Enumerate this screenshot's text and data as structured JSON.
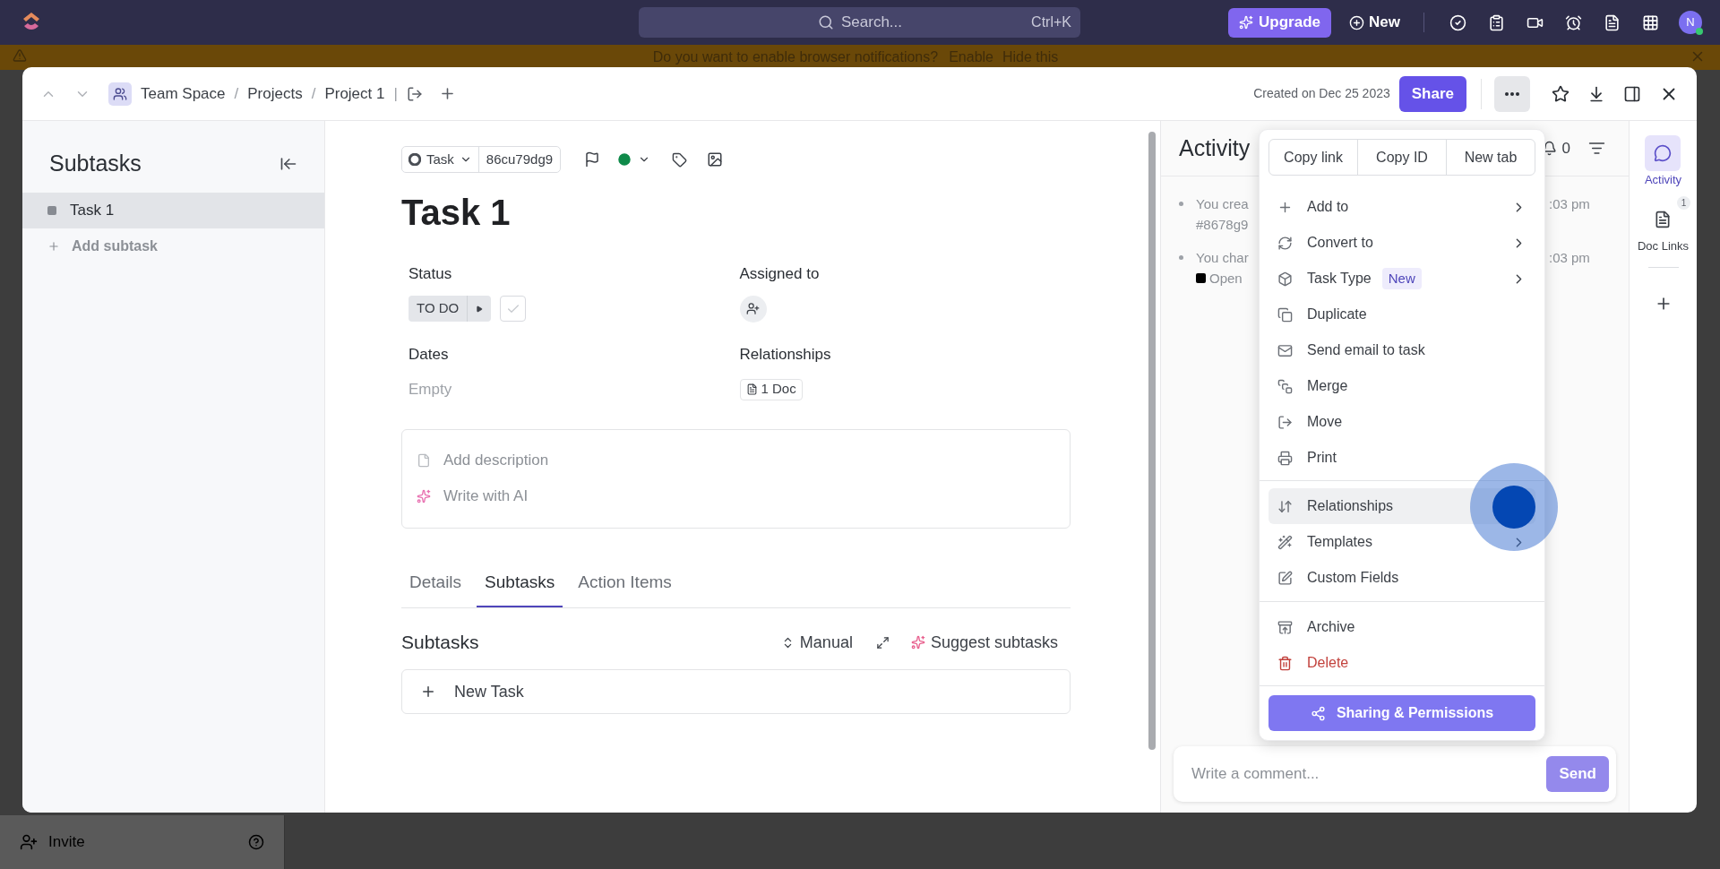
{
  "top_bar": {
    "search": {
      "placeholder": "Search...",
      "shortcut": "Ctrl+K"
    },
    "upgrade": "Upgrade",
    "new": "New",
    "avatar": "N"
  },
  "banner": {
    "text": "Do you want to enable browser notifications?",
    "links": [
      "Enable",
      "Hide this"
    ]
  },
  "header": {
    "breadcrumb": [
      {
        "label": "Team Space",
        "separator": "/"
      },
      {
        "label": "Projects",
        "separator": "/"
      },
      {
        "label": "Project 1",
        "separator": "|"
      }
    ],
    "created": "Created on Dec 25 2023",
    "share": "Share"
  },
  "subtasks_panel": {
    "title": "Subtasks",
    "items": [
      {
        "label": "Task 1",
        "selected": true
      }
    ],
    "add": "Add subtask"
  },
  "task": {
    "type": "Task",
    "id": "86cu79dg9",
    "title": "Task 1",
    "fields": [
      {
        "label": "Status",
        "kind": "status",
        "value": "TO DO",
        "completed": false
      },
      {
        "label": "Assigned to",
        "kind": "assignee"
      },
      {
        "label": "Dates",
        "kind": "empty",
        "value": "Empty"
      },
      {
        "label": "Relationships",
        "kind": "doc",
        "value": "1 Doc"
      }
    ],
    "description": {
      "placeholder": "Add description",
      "ai": "Write with AI"
    },
    "tabs": [
      {
        "label": "Details",
        "selected": false
      },
      {
        "label": "Subtasks",
        "selected": true
      },
      {
        "label": "Action Items",
        "selected": false
      }
    ],
    "subtasks": {
      "title": "Subtasks",
      "sort": "Manual",
      "suggest": "Suggest subtasks",
      "new_task": "New Task"
    }
  },
  "activity": {
    "title": "Activity",
    "bell_count": "0",
    "entries": [
      {
        "text": "You crea",
        "text_2": "#8678g9",
        "time": ":03 pm"
      },
      {
        "text": "You char",
        "text_2": "Open",
        "time": ":03 pm"
      }
    ],
    "comment": {
      "placeholder": "Write a comment...",
      "send": "Send",
      "disabled": true
    }
  },
  "rail": [
    {
      "label": "Activity",
      "selected": true
    },
    {
      "label": "Doc Links",
      "selected": false,
      "badge": "1"
    }
  ],
  "menu": {
    "top_buttons": [
      "Copy link",
      "Copy ID",
      "New tab"
    ],
    "sections": [
      [
        {
          "label": "Add to",
          "submenu": true,
          "highlighted": false,
          "danger": false
        },
        {
          "label": "Convert to",
          "submenu": true,
          "highlighted": false,
          "danger": false
        },
        {
          "label": "Task Type",
          "badge": "New",
          "submenu": true,
          "highlighted": false,
          "danger": false
        },
        {
          "label": "Duplicate",
          "submenu": false,
          "highlighted": false,
          "danger": false
        },
        {
          "label": "Send email to task",
          "submenu": false,
          "highlighted": false,
          "danger": false
        },
        {
          "label": "Merge",
          "submenu": false,
          "highlighted": false,
          "danger": false
        },
        {
          "label": "Move",
          "submenu": false,
          "highlighted": false,
          "danger": false
        },
        {
          "label": "Print",
          "submenu": false,
          "highlighted": false,
          "danger": false
        }
      ],
      [
        {
          "label": "Relationships",
          "submenu": false,
          "highlighted": true,
          "danger": false
        },
        {
          "label": "Templates",
          "submenu": true,
          "highlighted": false,
          "danger": false
        },
        {
          "label": "Custom Fields",
          "submenu": false,
          "highlighted": false,
          "danger": false
        }
      ],
      [
        {
          "label": "Archive",
          "submenu": false,
          "highlighted": false,
          "danger": false
        },
        {
          "label": "Delete",
          "submenu": false,
          "highlighted": false,
          "danger": true
        }
      ]
    ],
    "primary": "Sharing & Permissions"
  },
  "sidebar_footer": {
    "invite": "Invite"
  }
}
